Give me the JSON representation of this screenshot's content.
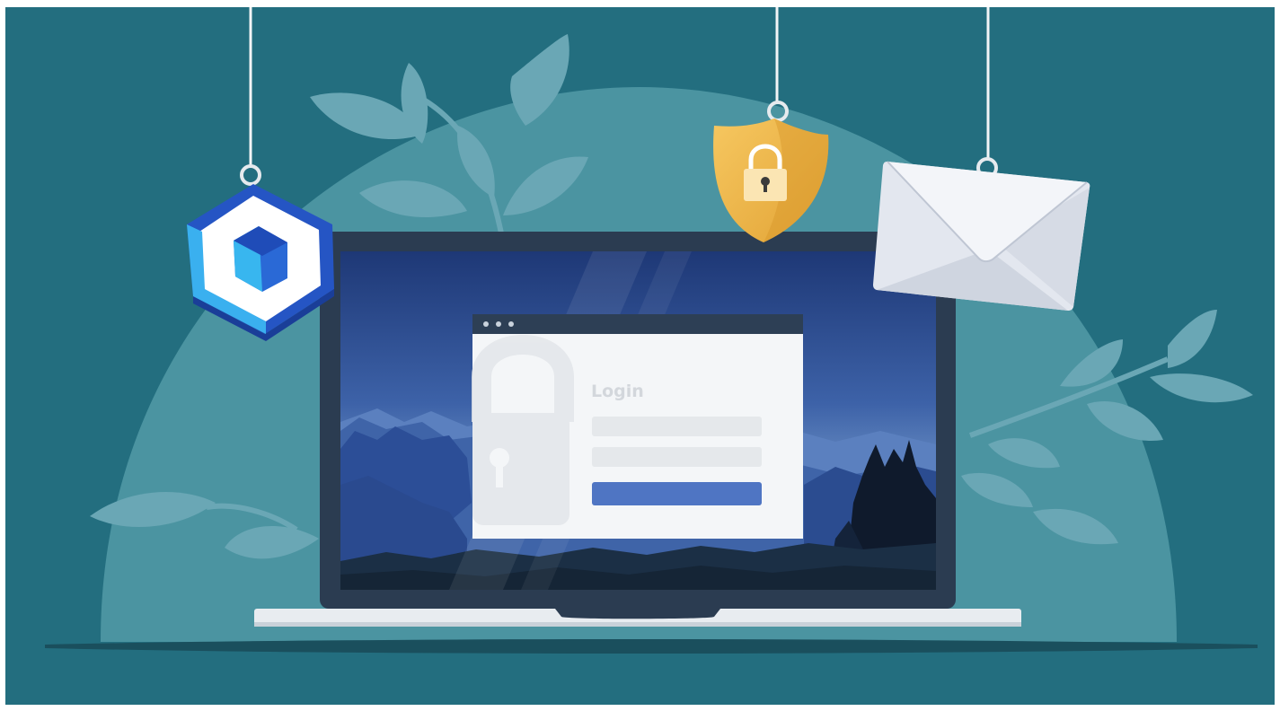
{
  "login_window": {
    "title": "Login",
    "username_placeholder": "",
    "password_placeholder": "",
    "submit_label": ""
  },
  "colors": {
    "background": "#236e7f",
    "dome": "#4d95a2",
    "leaf": "#72adbb",
    "laptop_bezel": "#2c3e52",
    "screen_sky_top": "#1f3b7a",
    "screen_sky_bottom": "#7da3cf",
    "login_button": "#4f74c2",
    "login_field": "#e6e9ec",
    "shield": "#f2b94b",
    "envelope": "#e4e8f0",
    "hexagon": "#2f5ed0"
  },
  "icons": [
    "hexagon-cube-icon",
    "shield-lock-icon",
    "envelope-icon",
    "padlock-icon"
  ]
}
